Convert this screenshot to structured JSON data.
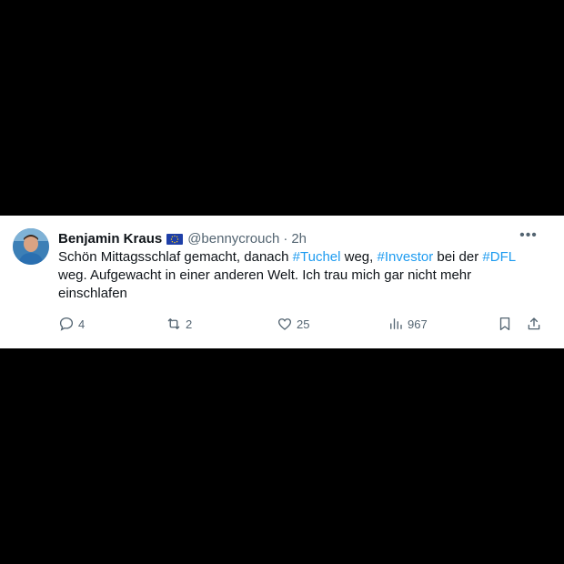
{
  "author": {
    "name": "Benjamin Kraus",
    "handle": "@bennycrouch",
    "time": "2h",
    "flag_icon": "eu-flag-icon"
  },
  "tweet": {
    "text_parts": [
      {
        "t": "Schön Mittagsschlaf gemacht, danach ",
        "tag": false
      },
      {
        "t": "#Tuchel",
        "tag": true
      },
      {
        "t": " weg, ",
        "tag": false
      },
      {
        "t": "#Investor",
        "tag": true
      },
      {
        "t": " bei der ",
        "tag": false
      },
      {
        "t": "#DFL",
        "tag": true
      },
      {
        "t": " weg. Aufgewacht in einer anderen Welt. Ich trau mich gar nicht mehr einschlafen",
        "tag": false
      }
    ]
  },
  "actions": {
    "replies": "4",
    "reposts": "2",
    "likes": "25",
    "views": "967"
  },
  "colors": {
    "hashtag": "#1d9bf0",
    "text": "#0f1419",
    "muted": "#536471",
    "background": "#000000"
  }
}
